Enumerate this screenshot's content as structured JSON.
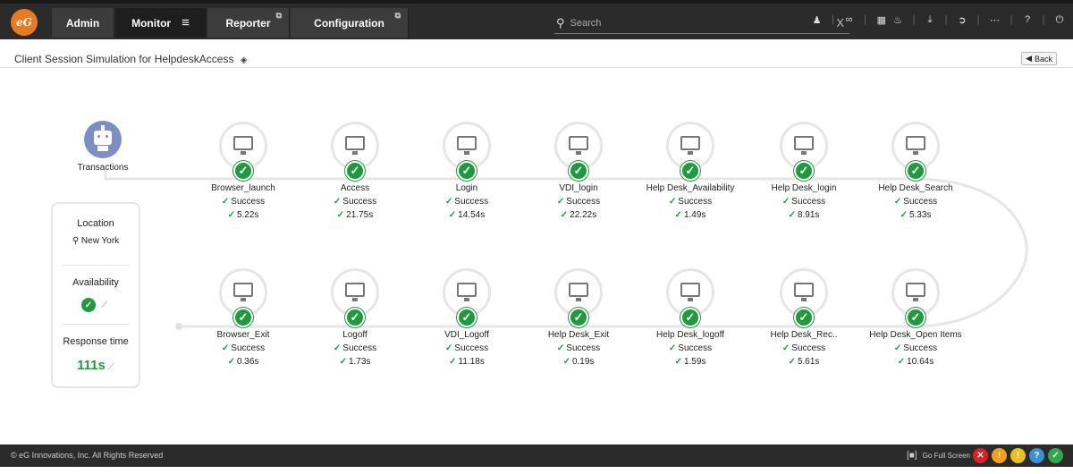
{
  "header": {
    "logo_text": "eG",
    "tabs": [
      {
        "label": "Admin"
      },
      {
        "label": "Monitor"
      },
      {
        "label": "Reporter"
      },
      {
        "label": "Configuration"
      }
    ],
    "menu_glyph": "≡",
    "external_glyph": "⧉",
    "search_placeholder": "Search",
    "search_clear": "X",
    "toolbar_icons": [
      "user-icon",
      "link-icon",
      "image-icon",
      "bell-icon",
      "download-icon",
      "signin-icon",
      "more-icon",
      "help-icon",
      "power-icon"
    ]
  },
  "page": {
    "title": "Client Session Simulation for HelpdeskAccess",
    "layers_glyph": "◈",
    "back_label": "Back",
    "back_glyph": "◀"
  },
  "robot_label": "Transactions",
  "summary": {
    "location_label": "Location",
    "location_value": "New York",
    "location_glyph": "⚲",
    "availability_label": "Availability",
    "response_time_label": "Response time",
    "response_time_value": "111s",
    "trend_glyph": "⟋"
  },
  "steps_top": [
    {
      "name": "Browser_launch",
      "status": "Success",
      "time": "5.22s"
    },
    {
      "name": "Access",
      "status": "Success",
      "time": "21.75s"
    },
    {
      "name": "Login",
      "status": "Success",
      "time": "14.54s"
    },
    {
      "name": "VDI_login",
      "status": "Success",
      "time": "22.22s"
    },
    {
      "name": "Help Desk_Availability",
      "status": "Success",
      "time": "1.49s"
    },
    {
      "name": "Help Desk_login",
      "status": "Success",
      "time": "8.91s"
    },
    {
      "name": "Help Desk_Search",
      "status": "Success",
      "time": "5.33s"
    }
  ],
  "steps_bottom": [
    {
      "name": "Browser_Exit",
      "status": "Success",
      "time": "0.36s"
    },
    {
      "name": "Logoff",
      "status": "Success",
      "time": "1.73s"
    },
    {
      "name": "VDI_Logoff",
      "status": "Success",
      "time": "11.18s"
    },
    {
      "name": "Help Desk_Exit",
      "status": "Success",
      "time": "0.19s"
    },
    {
      "name": "Help Desk_logoff",
      "status": "Success",
      "time": "1.59s"
    },
    {
      "name": "Help Desk_Rec..",
      "status": "Success",
      "time": "5.61s"
    },
    {
      "name": "Help Desk_Open Items",
      "status": "Success",
      "time": "10.64s"
    }
  ],
  "check_glyph": "✓",
  "footer": {
    "copyright": "© eG Innovations, Inc. All Rights Reserved",
    "fullscreen_label": "Go Full Screen",
    "fullscreen_glyph": "[■]",
    "alerts": [
      {
        "glyph": "✕",
        "color": "#e02020"
      },
      {
        "glyph": "!",
        "color": "#f2a01a"
      },
      {
        "glyph": "!",
        "color": "#e8c21a"
      },
      {
        "glyph": "?",
        "color": "#3a8fd6"
      },
      {
        "glyph": "✓",
        "color": "#2ea84a"
      }
    ]
  },
  "colors": {
    "success": "#1f9a3e",
    "topbar": "#2b2b2b",
    "logo": "#ea7a1e",
    "robot": "#7d8ec4"
  }
}
